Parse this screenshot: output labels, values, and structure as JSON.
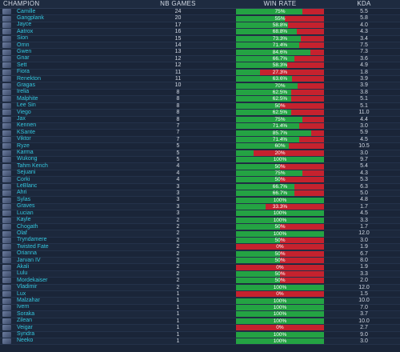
{
  "headers": {
    "champion": "CHAMPION",
    "games": "NB GAMES",
    "winrate": "WIN RATE",
    "kda": "KDA"
  },
  "colors": {
    "win": "#24a343",
    "loss": "#c5222e",
    "name": "#35c8e0"
  },
  "rows": [
    {
      "champion": "Camille",
      "games": "24",
      "winrate": "75%",
      "win_fraction": 0.75,
      "kda": "5.5"
    },
    {
      "champion": "Gangplank",
      "games": "20",
      "winrate": "55%",
      "win_fraction": 0.55,
      "kda": "5.8"
    },
    {
      "champion": "Jayce",
      "games": "17",
      "winrate": "58.8%",
      "win_fraction": 0.588,
      "kda": "4.0"
    },
    {
      "champion": "Aatrox",
      "games": "16",
      "winrate": "68.8%",
      "win_fraction": 0.688,
      "kda": "4.3"
    },
    {
      "champion": "Sion",
      "games": "15",
      "winrate": "73.3%",
      "win_fraction": 0.733,
      "kda": "3.4"
    },
    {
      "champion": "Ornn",
      "games": "14",
      "winrate": "71.4%",
      "win_fraction": 0.714,
      "kda": "7.5"
    },
    {
      "champion": "Gwen",
      "games": "13",
      "winrate": "84.6%",
      "win_fraction": 0.846,
      "kda": "7.3"
    },
    {
      "champion": "Gnar",
      "games": "12",
      "winrate": "66.7%",
      "win_fraction": 0.667,
      "kda": "3.6"
    },
    {
      "champion": "Sett",
      "games": "12",
      "winrate": "58.3%",
      "win_fraction": 0.583,
      "kda": "4.9"
    },
    {
      "champion": "Fiora",
      "games": "11",
      "winrate": "27.3%",
      "win_fraction": 0.273,
      "kda": "1.8"
    },
    {
      "champion": "Renekton",
      "games": "11",
      "winrate": "63.6%",
      "win_fraction": 0.636,
      "kda": "3.9"
    },
    {
      "champion": "Gragas",
      "games": "10",
      "winrate": "70%",
      "win_fraction": 0.7,
      "kda": "3.9"
    },
    {
      "champion": "Irelia",
      "games": "8",
      "winrate": "62.5%",
      "win_fraction": 0.625,
      "kda": "3.8"
    },
    {
      "champion": "Malphite",
      "games": "8",
      "winrate": "62.5%",
      "win_fraction": 0.625,
      "kda": "5.1"
    },
    {
      "champion": "Lee Sin",
      "games": "8",
      "winrate": "50%",
      "win_fraction": 0.5,
      "kda": "5.1"
    },
    {
      "champion": "Viego",
      "games": "8",
      "winrate": "62.5%",
      "win_fraction": 0.625,
      "kda": "11.0"
    },
    {
      "champion": "Jax",
      "games": "8",
      "winrate": "75%",
      "win_fraction": 0.75,
      "kda": "4.4"
    },
    {
      "champion": "Kennen",
      "games": "7",
      "winrate": "71.4%",
      "win_fraction": 0.714,
      "kda": "3.0"
    },
    {
      "champion": "KSante",
      "games": "7",
      "winrate": "85.7%",
      "win_fraction": 0.857,
      "kda": "5.9"
    },
    {
      "champion": "Viktor",
      "games": "7",
      "winrate": "71.4%",
      "win_fraction": 0.714,
      "kda": "4.5"
    },
    {
      "champion": "Ryze",
      "games": "5",
      "winrate": "60%",
      "win_fraction": 0.6,
      "kda": "10.5"
    },
    {
      "champion": "Karma",
      "games": "5",
      "winrate": "20%",
      "win_fraction": 0.2,
      "kda": "3.0"
    },
    {
      "champion": "Wukong",
      "games": "5",
      "winrate": "100%",
      "win_fraction": 1.0,
      "kda": "9.7"
    },
    {
      "champion": "Tahm Kench",
      "games": "4",
      "winrate": "50%",
      "win_fraction": 0.5,
      "kda": "5.4"
    },
    {
      "champion": "Sejuani",
      "games": "4",
      "winrate": "75%",
      "win_fraction": 0.75,
      "kda": "4.3"
    },
    {
      "champion": "Corki",
      "games": "4",
      "winrate": "50%",
      "win_fraction": 0.5,
      "kda": "5.3"
    },
    {
      "champion": "LeBlanc",
      "games": "3",
      "winrate": "66.7%",
      "win_fraction": 0.667,
      "kda": "6.3"
    },
    {
      "champion": "Ahri",
      "games": "3",
      "winrate": "66.7%",
      "win_fraction": 0.667,
      "kda": "5.0"
    },
    {
      "champion": "Sylas",
      "games": "3",
      "winrate": "100%",
      "win_fraction": 1.0,
      "kda": "4.8"
    },
    {
      "champion": "Graves",
      "games": "3",
      "winrate": "33.3%",
      "win_fraction": 0.333,
      "kda": "1.7"
    },
    {
      "champion": "Lucian",
      "games": "3",
      "winrate": "100%",
      "win_fraction": 1.0,
      "kda": "4.5"
    },
    {
      "champion": "Kayle",
      "games": "2",
      "winrate": "100%",
      "win_fraction": 1.0,
      "kda": "3.3"
    },
    {
      "champion": "Chogath",
      "games": "2",
      "winrate": "50%",
      "win_fraction": 0.5,
      "kda": "1.7"
    },
    {
      "champion": "Olaf",
      "games": "2",
      "winrate": "100%",
      "win_fraction": 1.0,
      "kda": "12.0"
    },
    {
      "champion": "Tryndamere",
      "games": "2",
      "winrate": "50%",
      "win_fraction": 0.5,
      "kda": "3.0"
    },
    {
      "champion": "Twisted Fate",
      "games": "2",
      "winrate": "0%",
      "win_fraction": 0.0,
      "kda": "1.9"
    },
    {
      "champion": "Orianna",
      "games": "2",
      "winrate": "50%",
      "win_fraction": 0.5,
      "kda": "6.7"
    },
    {
      "champion": "Jarvan IV",
      "games": "2",
      "winrate": "50%",
      "win_fraction": 0.5,
      "kda": "8.0"
    },
    {
      "champion": "Akali",
      "games": "2",
      "winrate": "0%",
      "win_fraction": 0.0,
      "kda": "1.9"
    },
    {
      "champion": "Lulu",
      "games": "2",
      "winrate": "50%",
      "win_fraction": 0.5,
      "kda": "3.3"
    },
    {
      "champion": "Mordekaiser",
      "games": "2",
      "winrate": "50%",
      "win_fraction": 0.5,
      "kda": "2.0"
    },
    {
      "champion": "Vladimir",
      "games": "2",
      "winrate": "100%",
      "win_fraction": 1.0,
      "kda": "12.0"
    },
    {
      "champion": "Lux",
      "games": "1",
      "winrate": "0%",
      "win_fraction": 0.0,
      "kda": "1.5"
    },
    {
      "champion": "Malzahar",
      "games": "1",
      "winrate": "100%",
      "win_fraction": 1.0,
      "kda": "10.0"
    },
    {
      "champion": "Ivern",
      "games": "1",
      "winrate": "100%",
      "win_fraction": 1.0,
      "kda": "7.0"
    },
    {
      "champion": "Soraka",
      "games": "1",
      "winrate": "100%",
      "win_fraction": 1.0,
      "kda": "3.7"
    },
    {
      "champion": "Zilean",
      "games": "1",
      "winrate": "100%",
      "win_fraction": 1.0,
      "kda": "10.0"
    },
    {
      "champion": "Veigar",
      "games": "1",
      "winrate": "0%",
      "win_fraction": 0.0,
      "kda": "2.7"
    },
    {
      "champion": "Syndra",
      "games": "1",
      "winrate": "100%",
      "win_fraction": 1.0,
      "kda": "9.0"
    },
    {
      "champion": "Neeko",
      "games": "1",
      "winrate": "100%",
      "win_fraction": 1.0,
      "kda": "3.0"
    }
  ]
}
